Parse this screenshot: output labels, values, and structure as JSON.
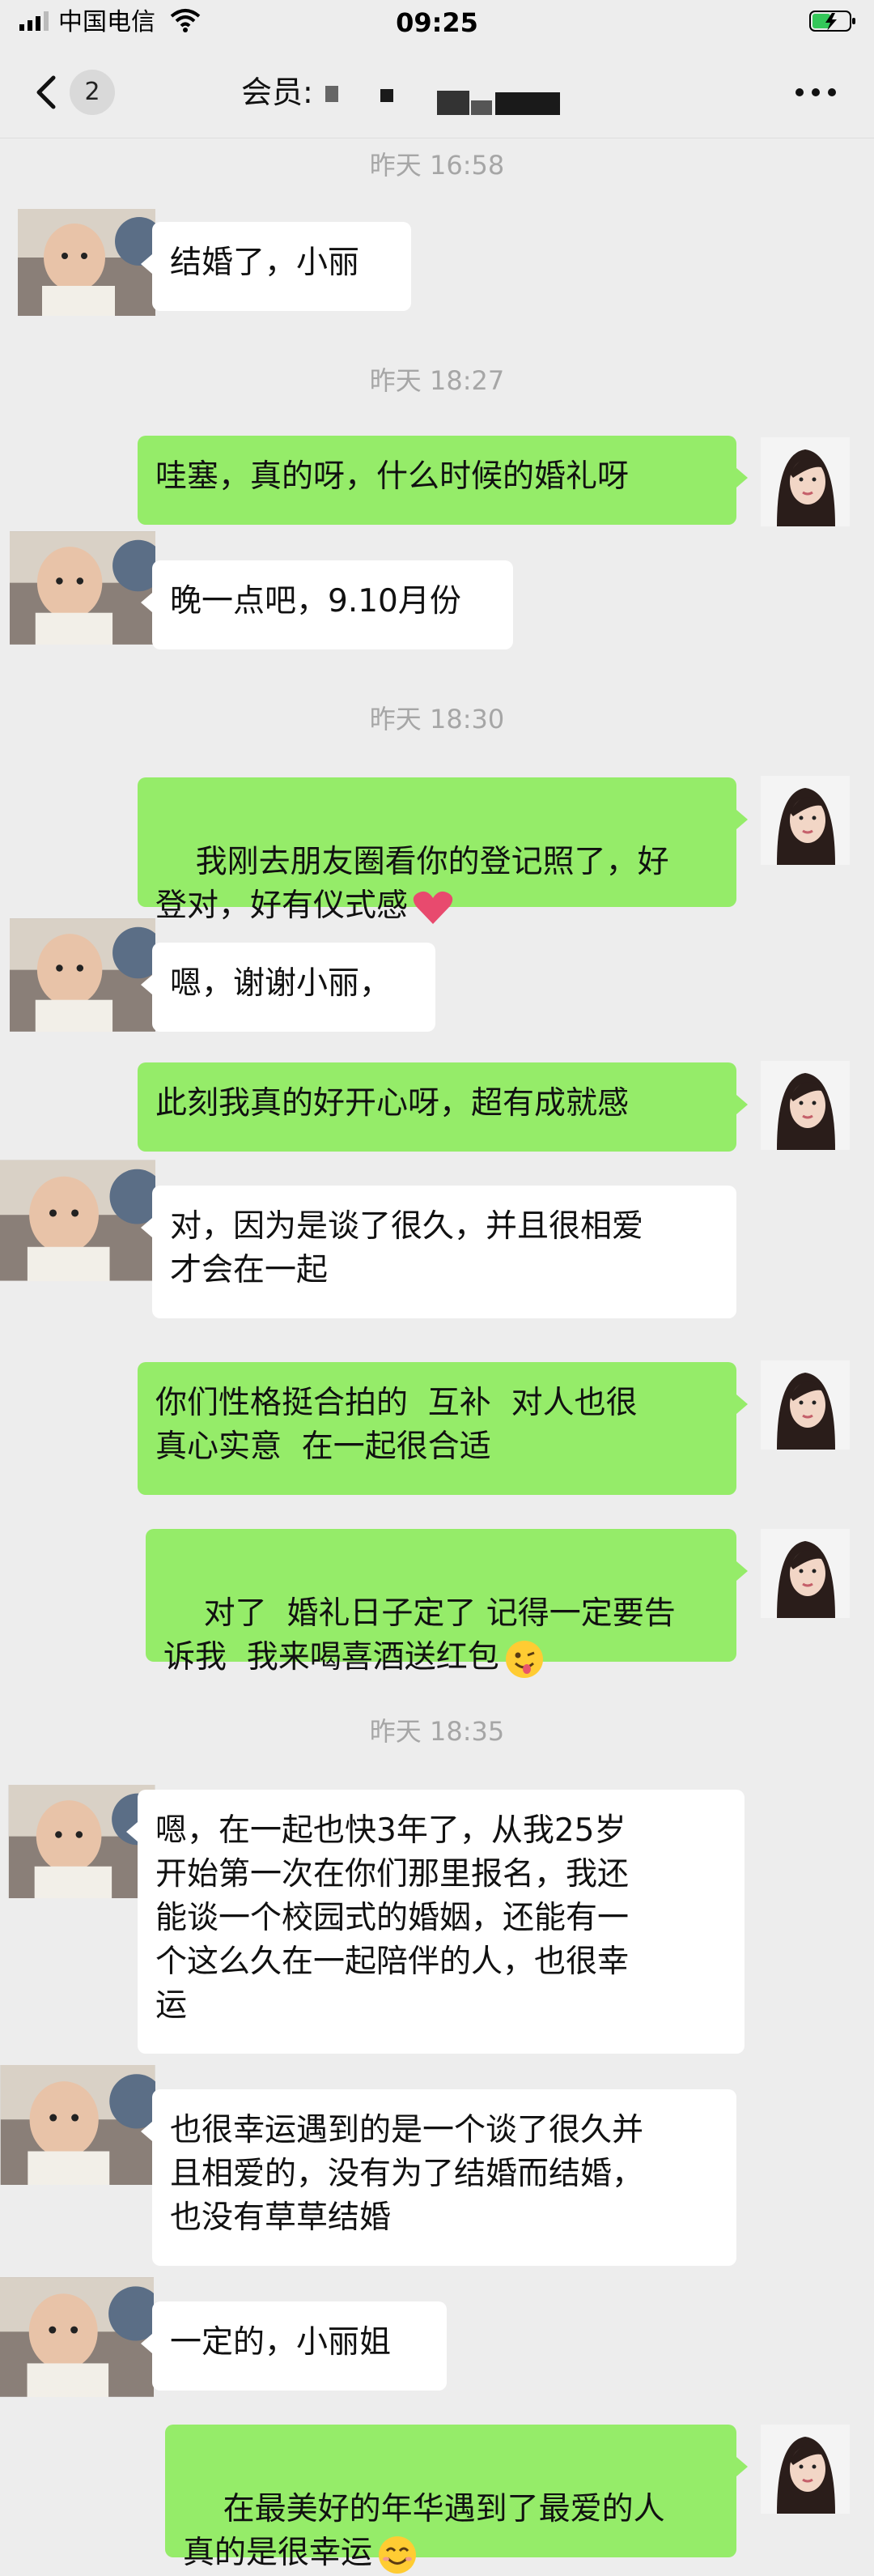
{
  "status_bar": {
    "carrier": "中国电信",
    "time": "09:25"
  },
  "header": {
    "unread_count": "2",
    "title": "会员:"
  },
  "timestamps": [
    "昨天 16:58",
    "昨天 18:27",
    "昨天 18:30",
    "昨天 18:35"
  ],
  "messages": [
    {
      "side": "left",
      "text": "结婚了，小丽"
    },
    {
      "side": "right",
      "text": "哇塞，真的呀，什么时候的婚礼呀"
    },
    {
      "side": "left",
      "text": "晚一点吧，9.10月份"
    },
    {
      "side": "right",
      "text": "我刚去朋友圈看你的登记照了，好\n登对，好有仪式感",
      "emoji": "heart-emoji"
    },
    {
      "side": "left",
      "text": "嗯，谢谢小丽，"
    },
    {
      "side": "right",
      "text": "此刻我真的好开心呀，超有成就感"
    },
    {
      "side": "left",
      "text": "对，因为是谈了很久，并且很相爱\n才会在一起"
    },
    {
      "side": "right",
      "text": "你们性格挺合拍的  互补  对人也很\n真心实意  在一起很合适"
    },
    {
      "side": "right",
      "text": "对了  婚礼日子定了 记得一定要告\n诉我  我来喝喜酒送红包",
      "emoji": "wink-tongue-emoji"
    },
    {
      "side": "left",
      "text": "嗯，在一起也快3年了，从我25岁\n开始第一次在你们那里报名，我还\n能谈一个校园式的婚姻，还能有一\n个这么久在一起陪伴的人，也很幸\n运"
    },
    {
      "side": "left",
      "text": "也很幸运遇到的是一个谈了很久并\n且相爱的，没有为了结婚而结婚，\n也没有草草结婚"
    },
    {
      "side": "left",
      "text": "一定的，小丽姐"
    },
    {
      "side": "right",
      "text": "在最美好的年华遇到了最爱的人\n真的是很幸运",
      "emoji": "smile-emoji"
    }
  ],
  "colors": {
    "background": "#ededed",
    "bubble_self": "#95ec69",
    "bubble_other": "#ffffff",
    "timestamp": "#a6a6a6"
  }
}
